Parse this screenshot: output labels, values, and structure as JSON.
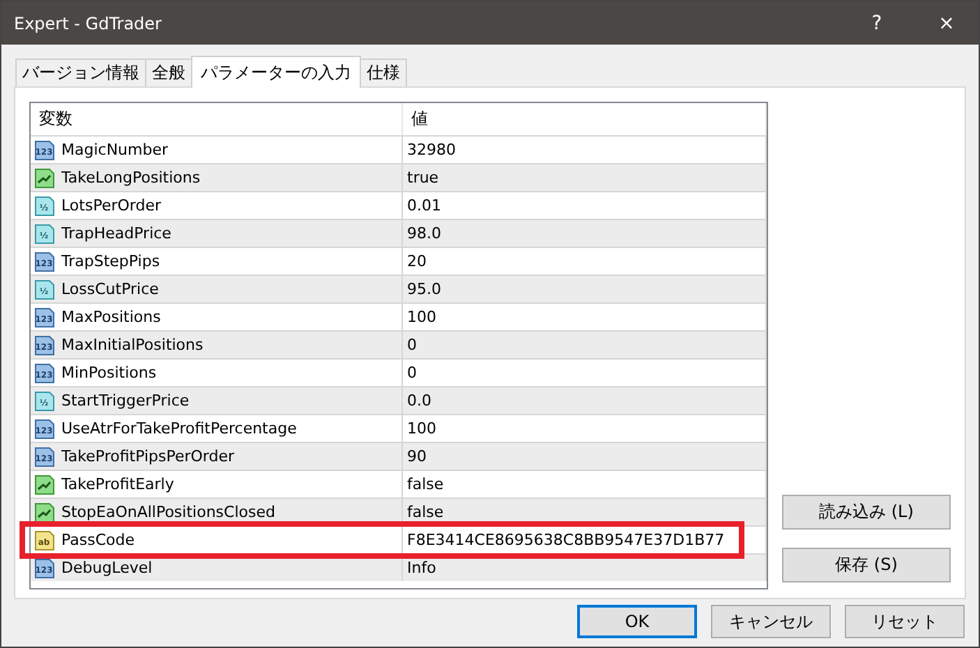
{
  "window": {
    "title": "Expert - GdTrader",
    "help": "?",
    "close": "×"
  },
  "tabs": [
    {
      "label": "バージョン情報",
      "selected": false
    },
    {
      "label": "全般",
      "selected": false
    },
    {
      "label": "パラメーターの入力",
      "selected": true
    },
    {
      "label": "仕様",
      "selected": false
    }
  ],
  "table": {
    "columns": [
      "変数",
      "値"
    ],
    "rows": [
      {
        "kind": "int",
        "icon": "123",
        "name": "MagicNumber",
        "value": "32980",
        "highlighted": false
      },
      {
        "kind": "bool",
        "name": "TakeLongPositions",
        "value": "true",
        "highlighted": false
      },
      {
        "kind": "double",
        "icon": "½",
        "name": "LotsPerOrder",
        "value": "0.01",
        "highlighted": false
      },
      {
        "kind": "double",
        "icon": "½",
        "name": "TrapHeadPrice",
        "value": "98.0",
        "highlighted": false
      },
      {
        "kind": "int",
        "icon": "123",
        "name": "TrapStepPips",
        "value": "20",
        "highlighted": false
      },
      {
        "kind": "double",
        "icon": "½",
        "name": "LossCutPrice",
        "value": "95.0",
        "highlighted": false
      },
      {
        "kind": "int",
        "icon": "123",
        "name": "MaxPositions",
        "value": "100",
        "highlighted": false
      },
      {
        "kind": "int",
        "icon": "123",
        "name": "MaxInitialPositions",
        "value": "0",
        "highlighted": false
      },
      {
        "kind": "int",
        "icon": "123",
        "name": "MinPositions",
        "value": "0",
        "highlighted": false
      },
      {
        "kind": "double",
        "icon": "½",
        "name": "StartTriggerPrice",
        "value": "0.0",
        "highlighted": false
      },
      {
        "kind": "int",
        "icon": "123",
        "name": "UseAtrForTakeProfitPercentage",
        "value": "100",
        "highlighted": false
      },
      {
        "kind": "int",
        "icon": "123",
        "name": "TakeProfitPipsPerOrder",
        "value": "90",
        "highlighted": false
      },
      {
        "kind": "bool",
        "name": "TakeProfitEarly",
        "value": "false",
        "highlighted": false
      },
      {
        "kind": "bool",
        "name": "StopEaOnAllPositionsClosed",
        "value": "false",
        "highlighted": false
      },
      {
        "kind": "string",
        "icon": "ab",
        "name": "PassCode",
        "value": "F8E3414CE8695638C8BB9547E37D1B77",
        "highlighted": true
      },
      {
        "kind": "int",
        "icon": "123",
        "name": "DebugLevel",
        "value": "Info",
        "highlighted": false
      }
    ]
  },
  "side_buttons": [
    "読み込み (L)",
    "保存 (S)"
  ],
  "buttons": [
    {
      "label": "OK",
      "default": true
    },
    {
      "label": "キャンセル",
      "default": false
    },
    {
      "label": "リセット",
      "default": false
    }
  ]
}
